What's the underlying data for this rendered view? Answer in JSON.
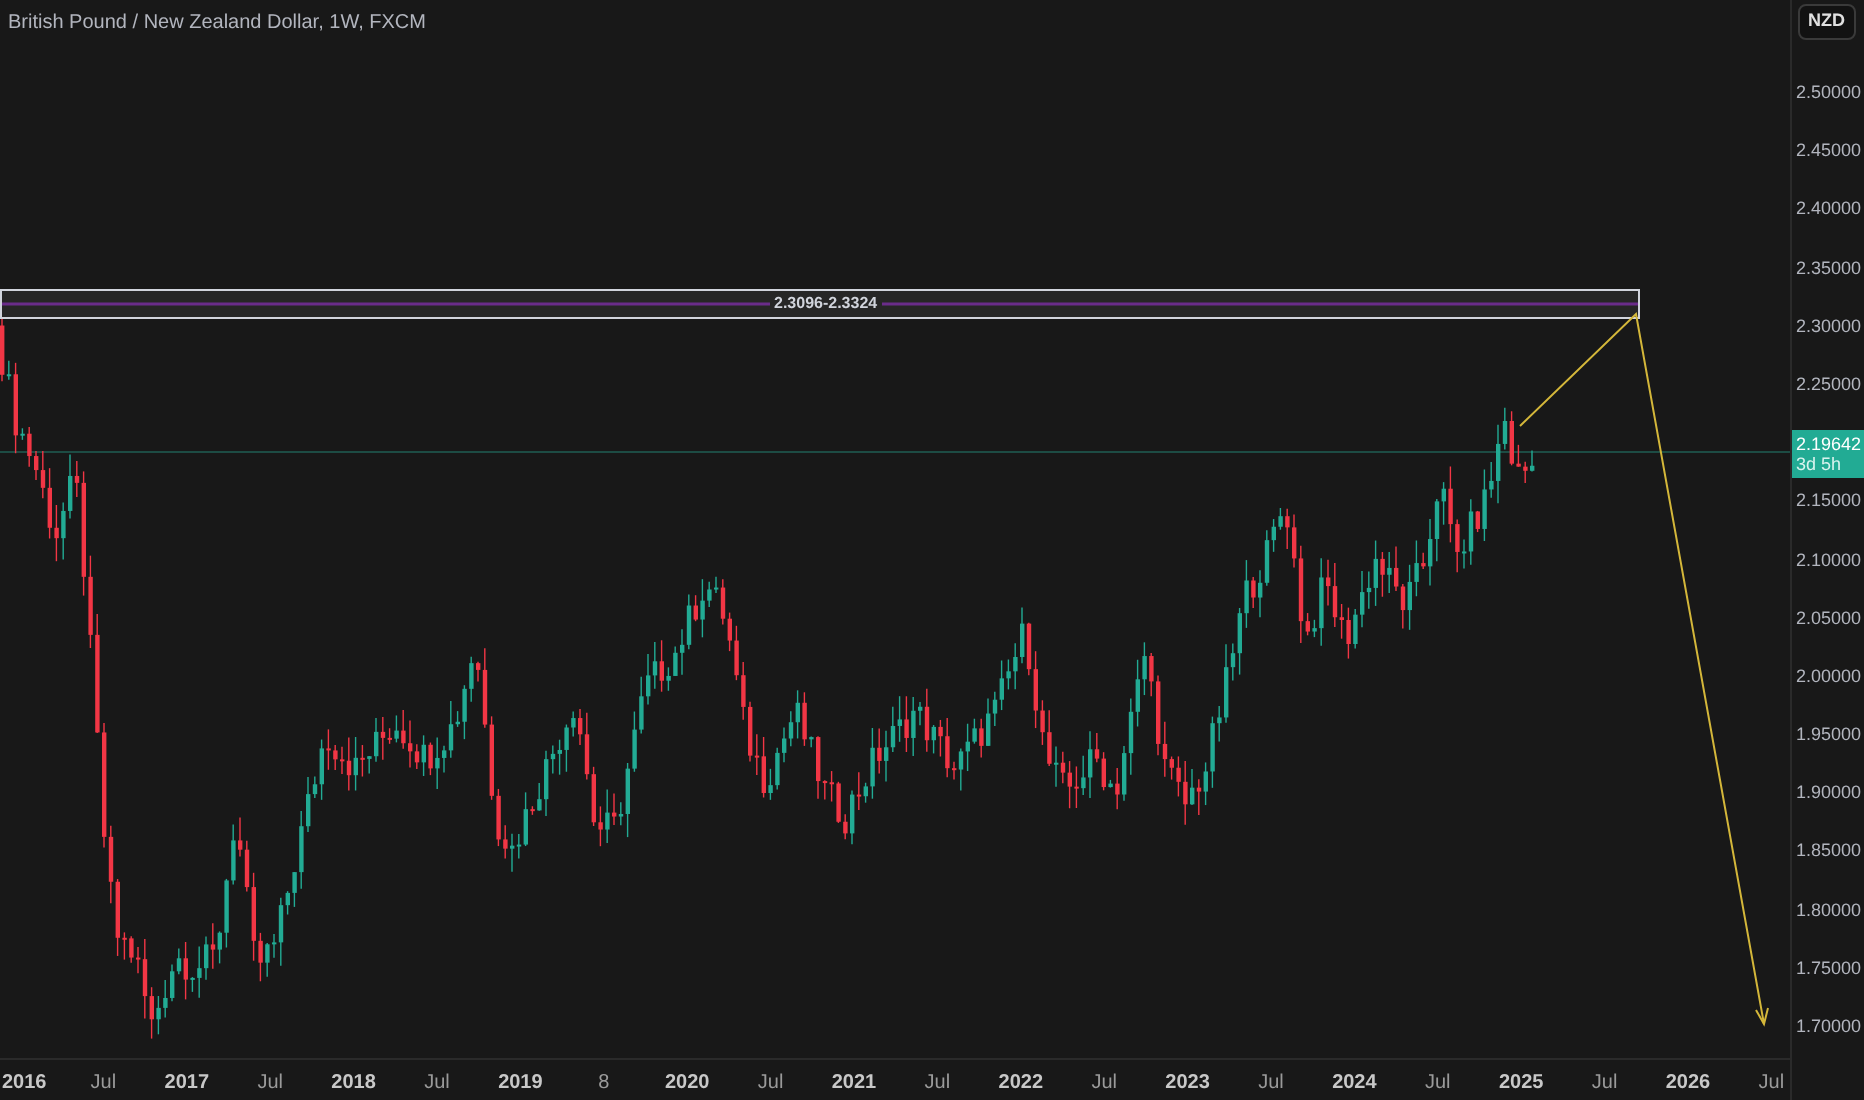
{
  "chart": {
    "title": "British Pound / New Zealand Dollar, 1W, FXCM",
    "zone_label": "2.3096-2.3324",
    "currency": "NZD",
    "price_axis": [
      "2.50000",
      "2.45000",
      "2.40000",
      "2.35000",
      "2.30000",
      "2.25000",
      "2.15000",
      "2.10000",
      "2.05000",
      "2.00000",
      "1.95000",
      "1.90000",
      "1.85000",
      "1.80000",
      "1.75000",
      "1.70000"
    ],
    "last_price": "2.19642",
    "countdown": "3d 5h",
    "time_axis": [
      "2016",
      "Jul",
      "2017",
      "Jul",
      "2018",
      "Jul",
      "2019",
      "8",
      "2020",
      "Jul",
      "2021",
      "Jul",
      "2022",
      "Jul",
      "2023",
      "Jul",
      "2024",
      "Jul",
      "2025",
      "Jul",
      "2026",
      "Jul"
    ]
  }
}
